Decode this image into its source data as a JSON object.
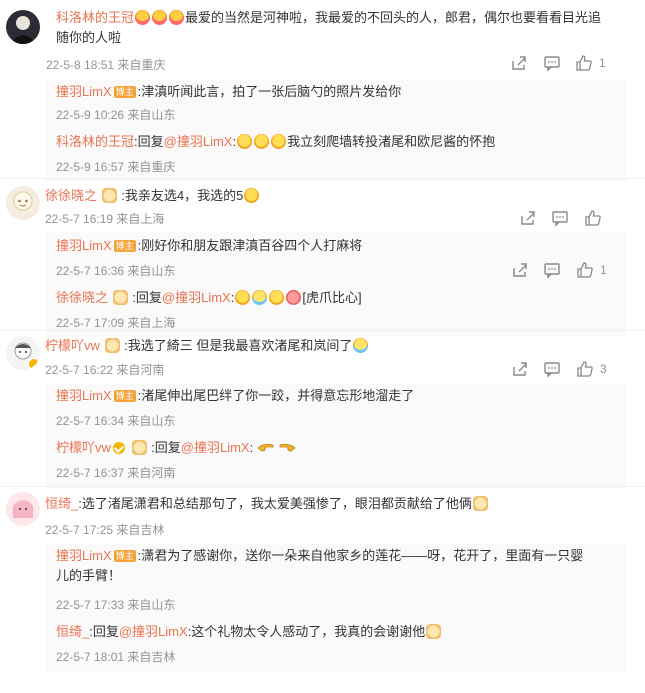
{
  "badge_label": "博主",
  "comments": [
    {
      "user": "科洛林的王冠",
      "text": "最爱的当然是河神啦，我最爱的不回头的人，郎君，偶尔也要看看目光追",
      "text2": "随你的人啦",
      "meta": "22-5-8 18:51 来自重庆",
      "likes": "1",
      "replies": [
        {
          "user": "撞羽LimX",
          "sep": ":",
          "text": "津滇听闻此言，拍了一张后脑勺的照片发给你",
          "meta": "22-5-9 10:26 来自山东"
        },
        {
          "user": "科洛林的王冠",
          "sep": ":回复",
          "mention": "@撞羽LimX",
          "text": ":",
          "text_after": "我立刻爬墙转投渚尾和欧尼酱的怀抱",
          "meta": "22-5-9 16:57 来自重庆"
        }
      ]
    },
    {
      "user": "徐徐晓之",
      "text": ":我亲友选4，我选的5",
      "meta": "22-5-7 16:19 来自上海",
      "replies": [
        {
          "user": "撞羽LimX",
          "sep": ":",
          "text": "刚好你和朋友跟津滇百谷四个人打麻将",
          "meta": "22-5-7 16:36 来自山东",
          "likes": "1"
        },
        {
          "user": "徐徐晓之",
          "sep": ":回复",
          "mention": "@撞羽LimX",
          "text": ":",
          "text_after": "[虎爪比心]",
          "meta": "22-5-7 17:09 来自上海"
        }
      ]
    },
    {
      "user": "柠檬吖vw",
      "text": ":我选了綺三 但是我最喜欢渚尾和岚间了",
      "meta": "22-5-7 16:22 来自河南",
      "likes": "3",
      "replies": [
        {
          "user": "撞羽LimX",
          "sep": ":",
          "text": "渚尾伸出尾巴绊了你一跤，并得意忘形地溜走了",
          "meta": "22-5-7 16:34 来自山东"
        },
        {
          "user": "柠檬吖vw",
          "sep": ":回复",
          "mention": "@撞羽LimX",
          "text": ":",
          "text_after": "",
          "meta": "22-5-7 16:37 来自河南"
        }
      ]
    },
    {
      "user": "恒绮_",
      "text": ":选了渚尾潇君和总结那句了，我太爱美强惨了，眼泪都贡献给了他俩",
      "meta": "22-5-7 17:25 来自吉林",
      "replies": [
        {
          "user": "撞羽LimX",
          "sep": ":",
          "text": "潇君为了感谢你，送你一朵来自他家乡的莲花——呀，花开了，里面有一只婴",
          "text2": "儿的手臂！",
          "meta": "22-5-7 17:33 来自山东"
        },
        {
          "user": "恒绮_",
          "sep": ":回复",
          "mention": "@撞羽LimX",
          "text": ":这个礼物太令人感动了，我真的会谢谢他",
          "meta": "22-5-7 18:01 来自吉林"
        }
      ]
    }
  ]
}
